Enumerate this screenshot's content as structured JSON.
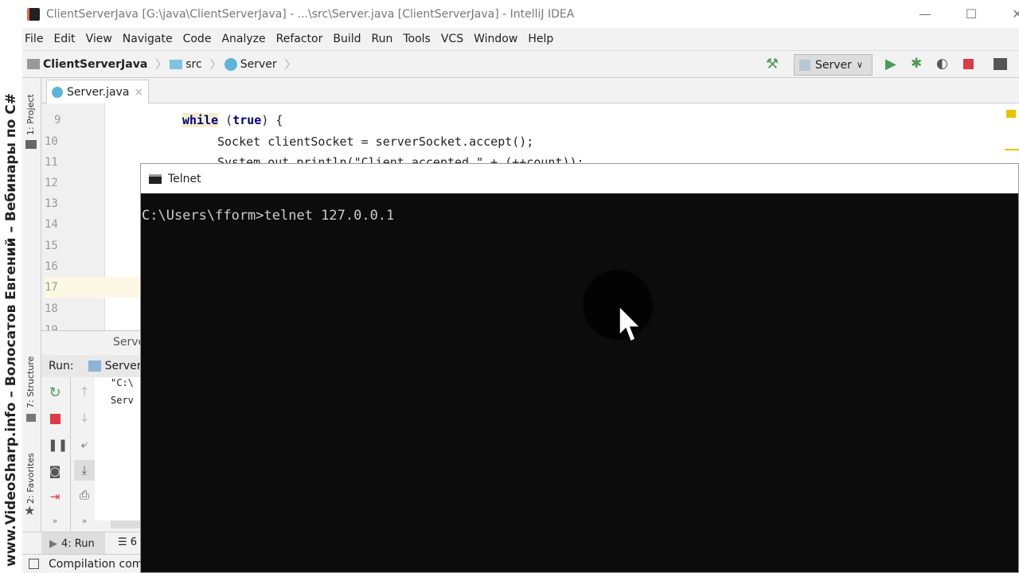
{
  "watermark": "www.VideoSharp.info – Волосатов Евгений – Вебинары по C#",
  "window": {
    "title": "ClientServerJava [G:\\java\\ClientServerJava] - ...\\src\\Server.java [ClientServerJava] - IntelliJ IDEA",
    "minimize": "—",
    "maximize": "☐",
    "close": "✕"
  },
  "menu": [
    "File",
    "Edit",
    "View",
    "Navigate",
    "Code",
    "Analyze",
    "Refactor",
    "Build",
    "Run",
    "Tools",
    "VCS",
    "Window",
    "Help"
  ],
  "breadcrumb": [
    "ClientServerJava",
    "src",
    "Server"
  ],
  "toolbar": {
    "run_config": "Server",
    "colors": {
      "run": "#499c54",
      "stop": "#db3c45"
    }
  },
  "editor_tab": {
    "label": "Server.java",
    "close": "×"
  },
  "side_tools": {
    "project": "1: Project",
    "structure": "7: Structure",
    "favorites": "2: Favorites"
  },
  "line_numbers": [
    "9",
    "10",
    "11",
    "12",
    "13",
    "14",
    "15",
    "16",
    "17",
    "18",
    "19"
  ],
  "code": {
    "l9_kw": "while",
    "l9_a": " (",
    "l9_kw2": "true",
    "l9_b": ") {",
    "l10": "Socket clientSocket = serverSocket.accept();",
    "l11": "System.out.println(\"Client accepted \" + (++count));"
  },
  "run_panel": {
    "header": "Server",
    "label": "Run:",
    "tab": "Server",
    "output": [
      "\"C:\\",
      "Serv"
    ],
    "more": "»"
  },
  "bottom_tabs": [
    "4: Run",
    "6"
  ],
  "status": "Compilation com",
  "telnet": {
    "title": "Telnet",
    "output": "C:\\Users\\fform>telnet 127.0.0.1"
  }
}
